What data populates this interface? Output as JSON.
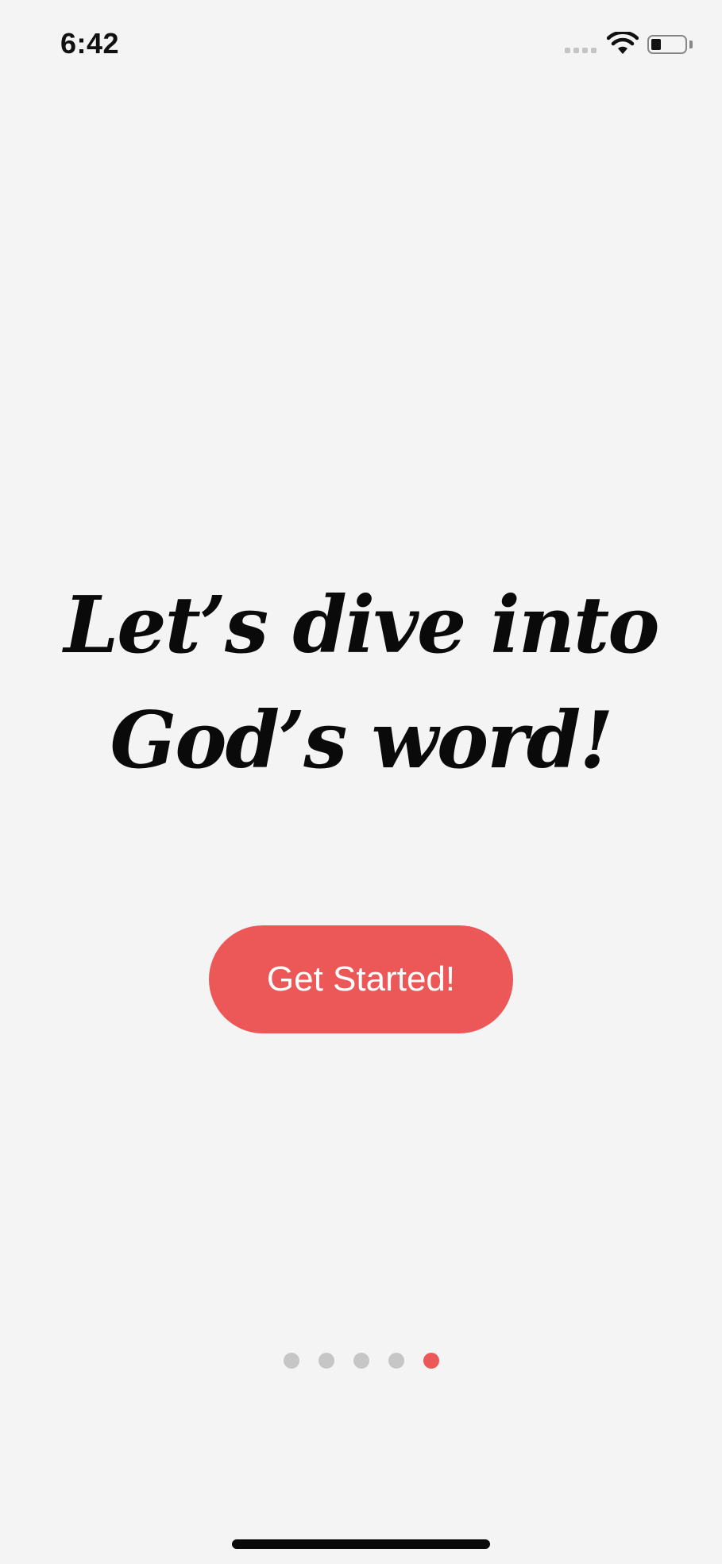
{
  "status_bar": {
    "time": "6:42",
    "icons": [
      "cellular-signal-icon",
      "wifi-icon",
      "battery-icon"
    ]
  },
  "onboarding": {
    "headline_line1": "Let’s dive into",
    "headline_line2": "God’s word!",
    "cta_label": "Get Started!",
    "page_count": 5,
    "current_page": 5
  },
  "colors": {
    "accent": "#ec5757",
    "background": "#f4f4f4",
    "dot_inactive": "#c6c6c6",
    "text": "#0a0a0a"
  }
}
